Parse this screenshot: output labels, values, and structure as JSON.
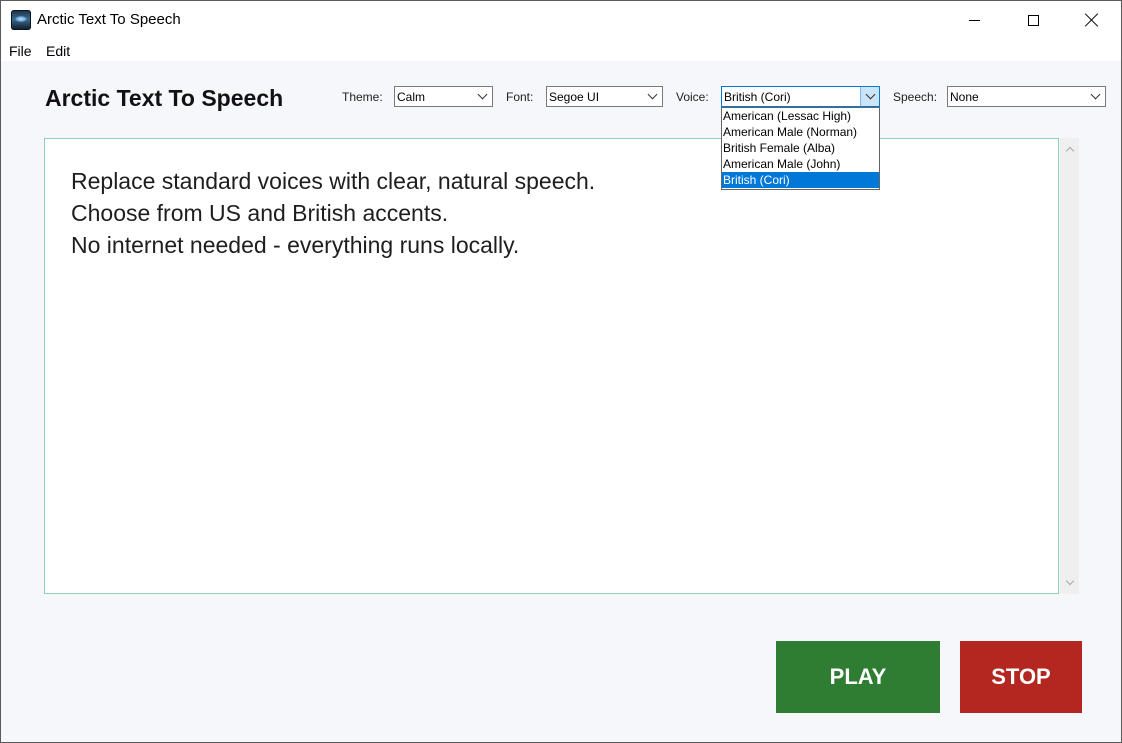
{
  "window": {
    "title": "Arctic Text To Speech",
    "icon": "arctic-app-icon"
  },
  "menu": {
    "file": "File",
    "edit": "Edit"
  },
  "header": {
    "title": "Arctic Text To Speech"
  },
  "controls": {
    "theme": {
      "label": "Theme:",
      "value": "Calm"
    },
    "font": {
      "label": "Font:",
      "value": "Segoe UI"
    },
    "voice": {
      "label": "Voice:",
      "value": "British (Cori)",
      "options": [
        "American (Lessac High)",
        "American Male (Norman)",
        "British Female (Alba)",
        "American Male (John)",
        "British (Cori)"
      ],
      "selected_index": 4
    },
    "speech": {
      "label": "Speech:",
      "value": "None"
    }
  },
  "editor": {
    "lines": [
      "Replace standard voices with clear, natural speech.",
      "Choose from US and British accents.",
      "No internet needed - everything runs locally."
    ]
  },
  "buttons": {
    "play": "PLAY",
    "stop": "STOP"
  },
  "colors": {
    "play": "#2e7d32",
    "stop": "#b42720",
    "selection": "#0078d7",
    "editor_border": "#8fd1bb"
  }
}
